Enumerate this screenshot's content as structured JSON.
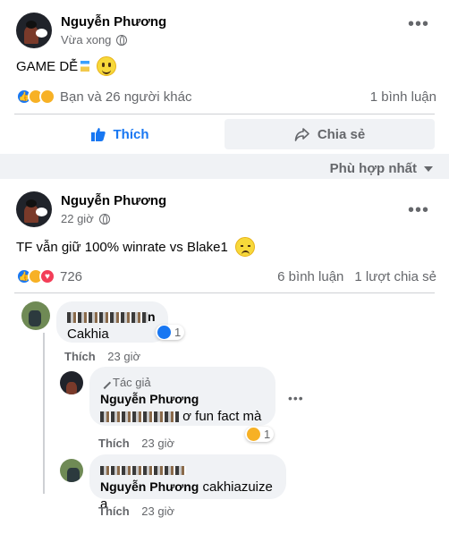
{
  "post1": {
    "author": "Nguyễn Phương",
    "time": "Vừa xong",
    "text": "GAME DỄ",
    "reactions_text": "Bạn và 26 người khác",
    "comments": "1 bình luận",
    "like_label": "Thích",
    "share_label": "Chia sẻ"
  },
  "sort_label": "Phù hợp nhất",
  "post2": {
    "author": "Nguyễn Phương",
    "time": "22 giờ",
    "text": "TF vẫn giữ 100% winrate vs Blake1",
    "reaction_count": "726",
    "comments": "6 bình luận",
    "shares": "1 lượt chia sẻ"
  },
  "comments": [
    {
      "name_suffix": "n",
      "text": "Cakhia",
      "reaction_count": "1",
      "action": "Thích",
      "time": "23 giờ"
    },
    {
      "tag": "Tác giả",
      "name": "Nguyễn Phương",
      "text": "ơ fun fact mà",
      "reaction_count": "1",
      "action": "Thích",
      "time": "23 giờ"
    },
    {
      "tagged_name": "Nguyễn Phương",
      "text": "cakhiazuize a",
      "action": "Thích",
      "time": "23 giờ"
    }
  ]
}
